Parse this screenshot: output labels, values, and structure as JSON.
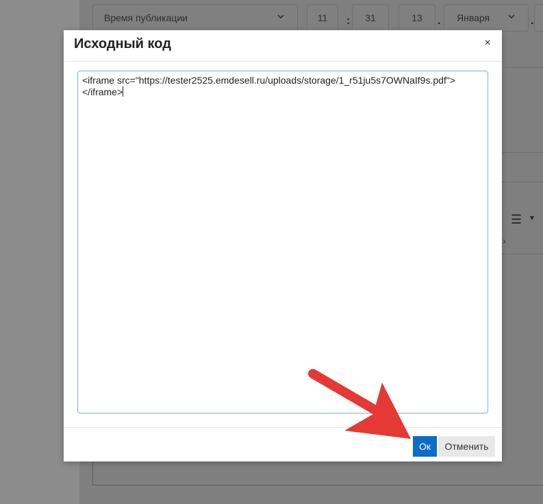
{
  "background": {
    "publish_time_label": "Время публикации",
    "hour": "11",
    "minute": "31",
    "day": "13",
    "month": "Января",
    "time_separator": ":",
    "date_separator": ".",
    "date_separator_2": "."
  },
  "modal": {
    "title": "Исходный код",
    "close_label": "×",
    "code_line_1": "<iframe src=\"https://tester2525.emdesell.ru/uploads/storage/1_r51ju5s7OWNaIf9s.pdf\">",
    "code_line_2": "</iframe>",
    "ok_label": "Ок",
    "cancel_label": "Отменить"
  },
  "colors": {
    "accent": "#0b6dc7",
    "annotation_arrow": "#e53935",
    "overlay": "#808080"
  },
  "icons": {
    "dropdown": "chevron-down-icon",
    "list": "bulleted-list-icon",
    "close": "close-icon"
  }
}
